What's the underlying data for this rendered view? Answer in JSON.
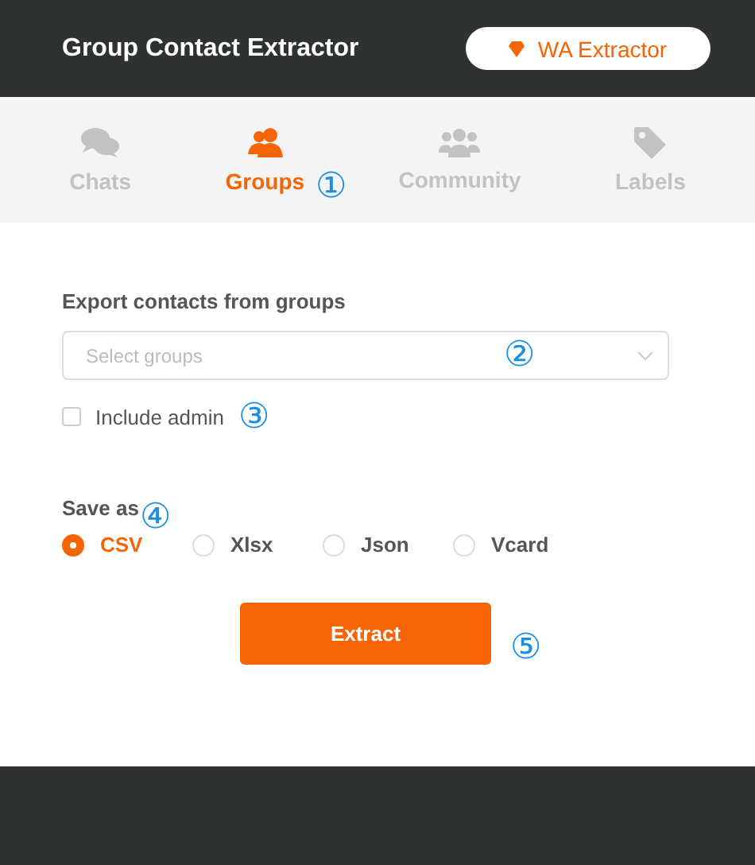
{
  "header": {
    "title": "Group Contact Extractor",
    "badge": "WA Extractor"
  },
  "tabs": [
    {
      "label": "Chats",
      "kind": "chats",
      "selected": false
    },
    {
      "label": "Groups",
      "kind": "groups",
      "selected": true,
      "callout": "①"
    },
    {
      "label": "Community",
      "kind": "community",
      "selected": false
    },
    {
      "label": "Labels",
      "kind": "labels",
      "selected": false
    }
  ],
  "export": {
    "heading": "Export contacts from groups",
    "select": {
      "placeholder": "Select groups",
      "callout": "②"
    },
    "include_admin": {
      "label": "Include admin",
      "checked": false,
      "callout": "③"
    }
  },
  "save_as": {
    "heading": "Save as",
    "callout": "④",
    "options": [
      {
        "label": "CSV",
        "selected": true
      },
      {
        "label": "Xlsx",
        "selected": false
      },
      {
        "label": "Json",
        "selected": false
      },
      {
        "label": "Vcard",
        "selected": false
      }
    ]
  },
  "extract_button": {
    "label": "Extract",
    "callout": "⑤"
  }
}
